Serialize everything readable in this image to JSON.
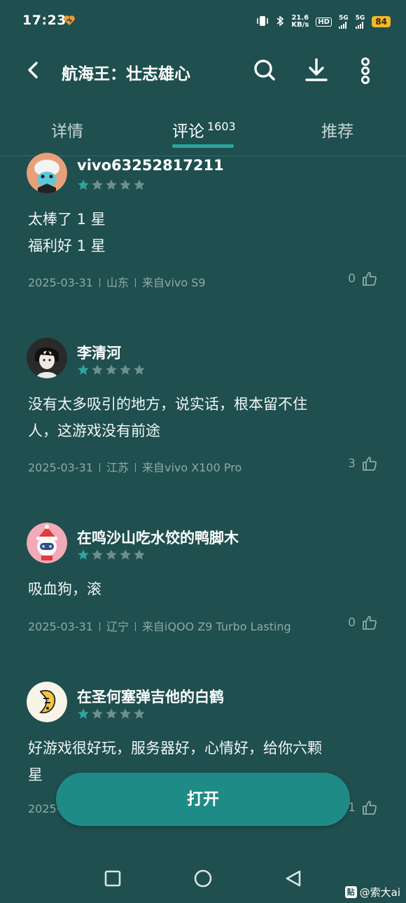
{
  "status": {
    "time": "17:23",
    "speed_top": "21.6",
    "speed_bottom": "KB/s",
    "hd": "HD",
    "net1": "5G",
    "net2": "5G",
    "battery": "84"
  },
  "header": {
    "title": "航海王：壮志雄心",
    "icons": [
      "back-arrow-icon",
      "search-icon",
      "download-icon",
      "more-vertical-icon"
    ]
  },
  "tabs": [
    {
      "label": "详情"
    },
    {
      "label": "评论",
      "count": "1603",
      "active": true
    },
    {
      "label": "推荐"
    }
  ],
  "reviews": [
    {
      "username": "vivo63252817211",
      "rating": 1,
      "text_lines": [
        "太棒了 1 星",
        "福利好 1 星"
      ],
      "date": "2025-03-31",
      "location": "山东",
      "device": "来自vivo S9",
      "likes": "0"
    },
    {
      "username": "李清河",
      "rating": 1,
      "text_lines": [
        "没有太多吸引的地方，说实话，根本留不住",
        "人，这游戏没有前途"
      ],
      "date": "2025-03-31",
      "location": "江苏",
      "device": "来自vivo X100 Pro",
      "likes": "3"
    },
    {
      "username": "在鸣沙山吃水饺的鸭脚木",
      "rating": 1,
      "text_lines": [
        "吸血狗，滚"
      ],
      "date": "2025-03-31",
      "location": "辽宁",
      "device": "来自iQOO Z9 Turbo Lasting",
      "likes": "0"
    },
    {
      "username": "在圣何塞弹吉他的白鹤",
      "rating": 1,
      "text_lines": [
        "好游戏很好玩，服务器好，心情好，给你六颗",
        "星"
      ],
      "date": "2025-",
      "location": "",
      "device": "",
      "likes": "1"
    }
  ],
  "open_button": {
    "label": "打开"
  },
  "watermark": {
    "badge": "贴",
    "text": "@索大ai"
  },
  "colors": {
    "background": "#1f4f4f",
    "accent": "#2aa6a0",
    "button": "#1f8b86",
    "star_filled": "#2aa6a0",
    "star_empty": "#6f8f8f",
    "battery": "#f4b82a"
  }
}
